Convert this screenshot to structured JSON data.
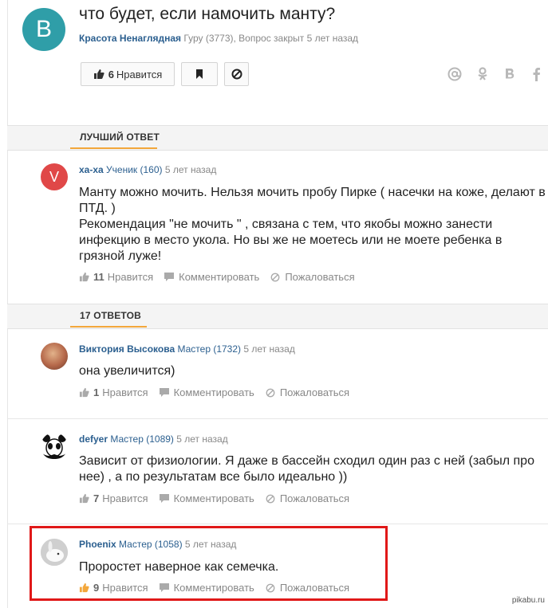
{
  "question": {
    "avatar_letter": "B",
    "title": "что будет, если намочить манту?",
    "author": "Красота Ненаглядная",
    "meta": "Гуру (3773), Вопрос закрыт 5 лет назад",
    "like_count": "6",
    "like_label": "Нравится"
  },
  "share_icons": [
    "at-icon",
    "odnoklassniki-icon",
    "vk-icon",
    "facebook-icon"
  ],
  "best_answer": {
    "section_label": "ЛУЧШИЙ ОТВЕТ",
    "avatar_letter": "V",
    "name": "ха-ха",
    "rank": "Ученик (160)",
    "time": "5 лет назад",
    "text_line1": "Манту можно мочить. Нельзя мочить пробу Пирке ( насечки на коже, делают в ПТД. )",
    "text_line2": "Рекомендация \"не мочить \" , связана с тем, что якобы можно занести инфекцию в место укола. Но вы же не моетесь или не моете ребенка в грязной луже!",
    "likes": "11"
  },
  "answers_section_label": "17 ОТВЕТОВ",
  "labels": {
    "like": "Нравится",
    "comment": "Комментировать",
    "report": "Пожаловаться"
  },
  "answers": [
    {
      "name": "Виктория Высокова",
      "rank": "Мастер (1732)",
      "time": "5 лет назад",
      "text": "она увеличится)",
      "likes": "1"
    },
    {
      "name": "defyer",
      "rank": "Мастер (1089)",
      "time": "5 лет назад",
      "text": "Зависит от физиологии. Я даже в бассейн сходил один раз с ней (забыл про нее) , а по результатам все было идеально ))",
      "likes": "7"
    },
    {
      "name": "Phoenix",
      "rank": "Мастер (1058)",
      "time": "5 лет назад",
      "text": "Проростет наверное как семечка.",
      "likes": "9"
    }
  ],
  "watermark": "pikabu.ru",
  "colors": {
    "accent": "#f3a73b",
    "link": "#2b5f8f",
    "highlight": "#e01818"
  }
}
